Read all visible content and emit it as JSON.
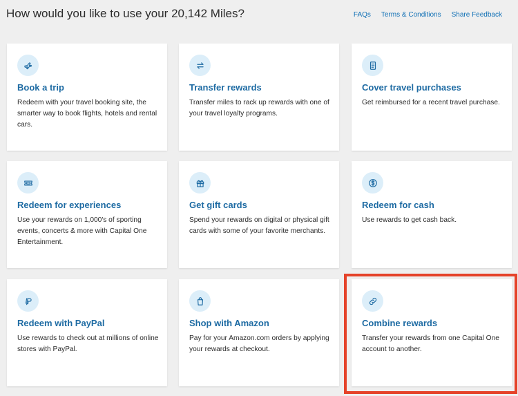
{
  "header": {
    "title": "How would you like to use your 20,142 Miles?",
    "links": [
      "FAQs",
      "Terms & Conditions",
      "Share Feedback"
    ]
  },
  "cards": [
    {
      "title": "Book a trip",
      "description": "Redeem with your travel booking site, the smarter way to book flights, hotels and rental cars.",
      "icon": "plane-icon"
    },
    {
      "title": "Transfer rewards",
      "description": "Transfer miles to rack up rewards with one of your travel loyalty programs.",
      "icon": "transfer-arrows-icon"
    },
    {
      "title": "Cover travel purchases",
      "description": "Get reimbursed for a recent travel purchase.",
      "icon": "receipt-icon"
    },
    {
      "title": "Redeem for experiences",
      "description": "Use your rewards on 1,000's of sporting events, concerts & more with Capital One Entertainment.",
      "icon": "ticket-icon"
    },
    {
      "title": "Get gift cards",
      "description": "Spend your rewards on digital or physical gift cards with some of your favorite merchants.",
      "icon": "gift-icon"
    },
    {
      "title": "Redeem for cash",
      "description": "Use rewards to get cash back.",
      "icon": "dollar-coin-icon"
    },
    {
      "title": "Redeem with PayPal",
      "description": "Use rewards to check out at millions of online stores with PayPal.",
      "icon": "paypal-icon"
    },
    {
      "title": "Shop with Amazon",
      "description": "Pay for your Amazon.com orders by applying your rewards at checkout.",
      "icon": "shopping-bag-icon"
    },
    {
      "title": "Combine rewards",
      "description": "Transfer your rewards from one Capital One account to another.",
      "icon": "link-icon"
    }
  ],
  "colors": {
    "accent": "#1e6ba3",
    "link": "#0f6fb5",
    "icon_bg": "#dceef9",
    "highlight": "#e5432a",
    "background": "#efefef"
  }
}
